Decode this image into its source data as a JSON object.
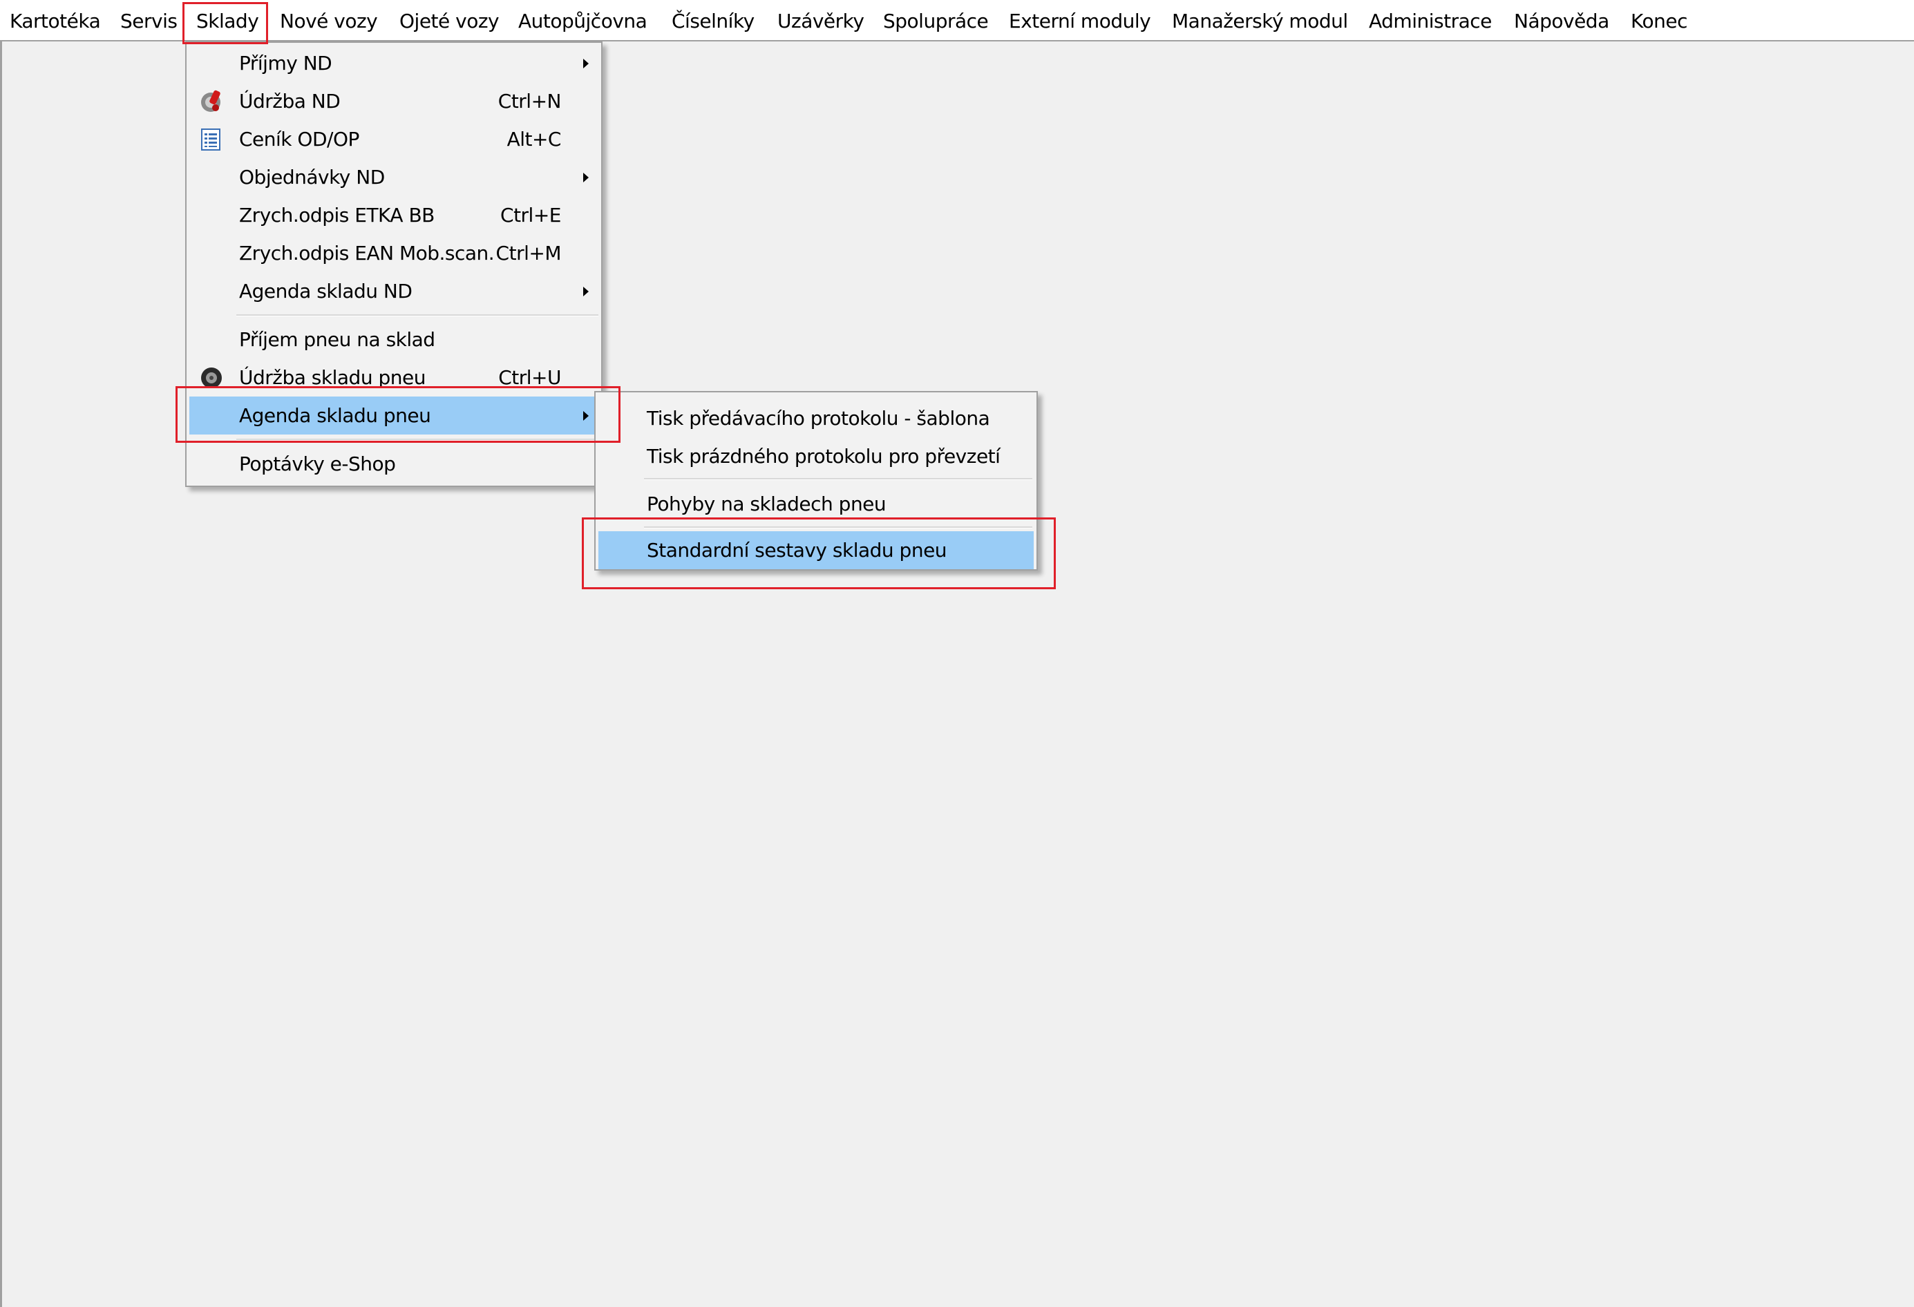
{
  "menubar": {
    "items": [
      {
        "label": "Kartotéka"
      },
      {
        "label": "Servis"
      },
      {
        "label": "Sklady"
      },
      {
        "label": "Nové vozy"
      },
      {
        "label": "Ojeté vozy"
      },
      {
        "label": "Autopůjčovna"
      },
      {
        "label": "Číselníky"
      },
      {
        "label": "Uzávěrky"
      },
      {
        "label": "Spolupráce"
      },
      {
        "label": "Externí moduly"
      },
      {
        "label": "Manažerský modul"
      },
      {
        "label": "Administrace"
      },
      {
        "label": "Nápověda"
      },
      {
        "label": "Konec"
      }
    ]
  },
  "sklady_menu": {
    "items": [
      {
        "label": "Příjmy ND",
        "shortcut": "",
        "submenu": true,
        "icon": ""
      },
      {
        "label": "Údržba ND",
        "shortcut": "Ctrl+N",
        "submenu": false,
        "icon": "maintenance-icon"
      },
      {
        "label": "Ceník OD/OP",
        "shortcut": "Alt+C",
        "submenu": false,
        "icon": "price-list-icon"
      },
      {
        "label": "Objednávky ND",
        "shortcut": "",
        "submenu": true,
        "icon": ""
      },
      {
        "label": "Zrych.odpis ETKA BB",
        "shortcut": "Ctrl+E",
        "submenu": false,
        "icon": ""
      },
      {
        "label": "Zrych.odpis EAN Mob.scan.",
        "shortcut": "Ctrl+M",
        "submenu": false,
        "icon": ""
      },
      {
        "label": "Agenda skladu ND",
        "shortcut": "",
        "submenu": true,
        "icon": ""
      },
      {
        "label": "Příjem pneu na sklad",
        "shortcut": "",
        "submenu": false,
        "icon": ""
      },
      {
        "label": "Údržba skladu pneu",
        "shortcut": "Ctrl+U",
        "submenu": false,
        "icon": "tire-icon"
      },
      {
        "label": "Agenda skladu pneu",
        "shortcut": "",
        "submenu": true,
        "icon": "",
        "selected": true
      },
      {
        "label": "Poptávky e-Shop",
        "shortcut": "",
        "submenu": false,
        "icon": ""
      }
    ]
  },
  "pneu_submenu": {
    "items": [
      {
        "label": "Tisk předávacího protokolu - šablona"
      },
      {
        "label": "Tisk prázdného protokolu pro převzetí"
      },
      {
        "label": "Pohyby na skladech pneu"
      },
      {
        "label": "Standardní sestavy skladu pneu",
        "selected": true
      }
    ]
  },
  "colors": {
    "selection": "#99ccf6",
    "highlight_box": "#e0202a",
    "menu_background": "#f2f2f2",
    "workspace": "#f0f0f0"
  }
}
